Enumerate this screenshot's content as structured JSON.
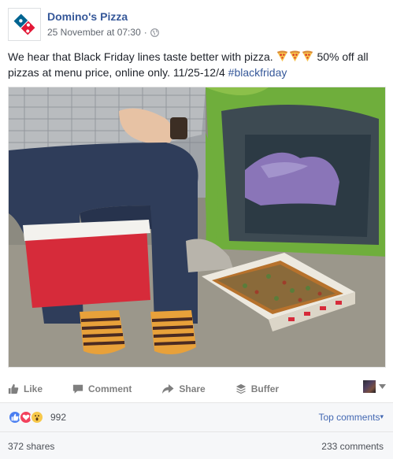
{
  "header": {
    "page_name": "Domino's Pizza",
    "timestamp": "25 November at 07:30",
    "separator": "·",
    "privacy_icon": "globe-icon"
  },
  "post": {
    "text_line1": "We hear that Black Friday lines taste better with pizza.",
    "text_line1_suffix": "50% off all",
    "pizza_emoji_count": 3,
    "text_line2": "pizzas at menu price, online only. 11/25-12/4",
    "hashtag": "#blackfriday",
    "photo_icon": "photo"
  },
  "actions": {
    "like_label": "Like",
    "comment_label": "Comment",
    "share_label": "Share",
    "buffer_label": "Buffer",
    "like_icon": "thumbs-up-icon",
    "comment_icon": "speech-bubble-icon",
    "share_icon": "share-arrow-icon",
    "buffer_icon": "buffer-stack-icon"
  },
  "reactions": {
    "icons": [
      "like-reaction",
      "love-reaction",
      "wow-reaction"
    ],
    "count": "992",
    "top_comments_label": "Top comments",
    "top_comments_arrow": "▾"
  },
  "stats": {
    "shares": "372 shares",
    "comments": "233 comments"
  },
  "colors": {
    "link_blue": "#365899",
    "accent_blue": "#4267b2",
    "muted": "#7f7f7f",
    "bar_bg": "#f6f7f9",
    "dominos_blue": "#006491",
    "dominos_red": "#e31837"
  }
}
